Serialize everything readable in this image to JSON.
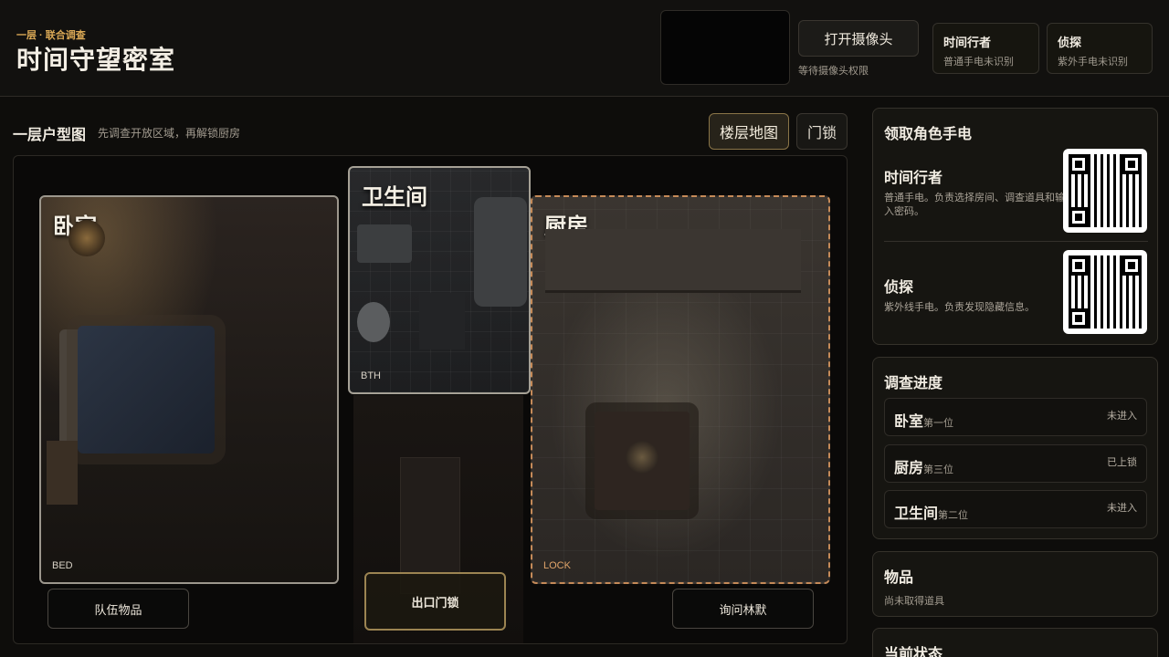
{
  "header": {
    "subtitle": "一层 · 联合调查",
    "title": "时间守望密室",
    "camera_button": "打开摄像头",
    "camera_status": "等待摄像头权限",
    "roles": [
      {
        "name": "时间行者",
        "status": "普通手电未识别"
      },
      {
        "name": "侦探",
        "status": "紫外手电未识别"
      }
    ]
  },
  "map": {
    "title": "一层户型图",
    "hint": "先调查开放区域，再解锁厨房",
    "tabs": {
      "floor": "楼层地图",
      "lock": "门锁"
    },
    "rooms": {
      "bedroom": {
        "label": "卧室",
        "code": "BED"
      },
      "bathroom": {
        "label": "卫生间",
        "code": "BTH"
      },
      "kitchen": {
        "label": "厨房",
        "code": "LOCK"
      }
    },
    "buttons": {
      "team": "队伍物品",
      "exit": "出口门锁",
      "ask": "询问林默"
    }
  },
  "flashlights": {
    "title": "领取角色手电",
    "items": [
      {
        "name": "时间行者",
        "desc": "普通手电。负责选择房间、调查道具和输入密码。"
      },
      {
        "name": "侦探",
        "desc": "紫外线手电。负责发现隐藏信息。"
      }
    ]
  },
  "progress": {
    "title": "调查进度",
    "items": [
      {
        "name": "卧室",
        "order": "第一位",
        "status": "未进入"
      },
      {
        "name": "厨房",
        "order": "第三位",
        "status": "已上锁"
      },
      {
        "name": "卫生间",
        "order": "第二位",
        "status": "未进入"
      }
    ]
  },
  "items": {
    "title": "物品",
    "empty": "尚未取得道具"
  },
  "status": {
    "title": "当前状态"
  },
  "colors": {
    "accent": "#d9a855",
    "kitchen_border": "#c58a58",
    "exit_border": "#9c8452"
  }
}
